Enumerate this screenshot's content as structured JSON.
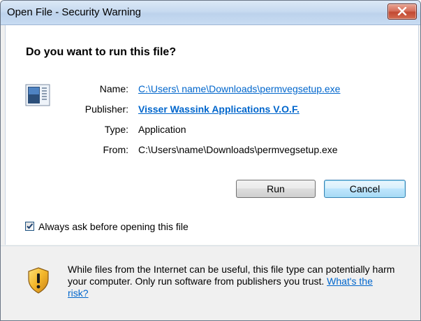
{
  "window": {
    "title": "Open File - Security Warning"
  },
  "dialog": {
    "question": "Do you want to run this file?",
    "fields": {
      "name_label": "Name:",
      "name_value": "C:\\Users\\ name\\Downloads\\permvegsetup.exe",
      "publisher_label": "Publisher:",
      "publisher_value": "Visser Wassink Applications V.O.F.",
      "type_label": "Type:",
      "type_value": "Application",
      "from_label": "From:",
      "from_value": "C:\\Users\\name\\Downloads\\permvegsetup.exe"
    },
    "buttons": {
      "run": "Run",
      "cancel": "Cancel"
    },
    "checkbox": {
      "label": "Always ask before opening this file",
      "checked": true
    }
  },
  "footer": {
    "warning_text": "While files from the Internet can be useful, this file type can potentially harm your computer. Only run software from publishers you trust.",
    "risk_link": "What's the risk?"
  },
  "icons": {
    "close": "close-icon",
    "app": "application-icon",
    "shield": "shield-warning-icon",
    "check": "checkmark-icon"
  },
  "colors": {
    "link": "#0066cc",
    "title_gradient_top": "#dbe8f6",
    "close_button": "#c24a33",
    "dialog_background": "#f0f0f0"
  }
}
